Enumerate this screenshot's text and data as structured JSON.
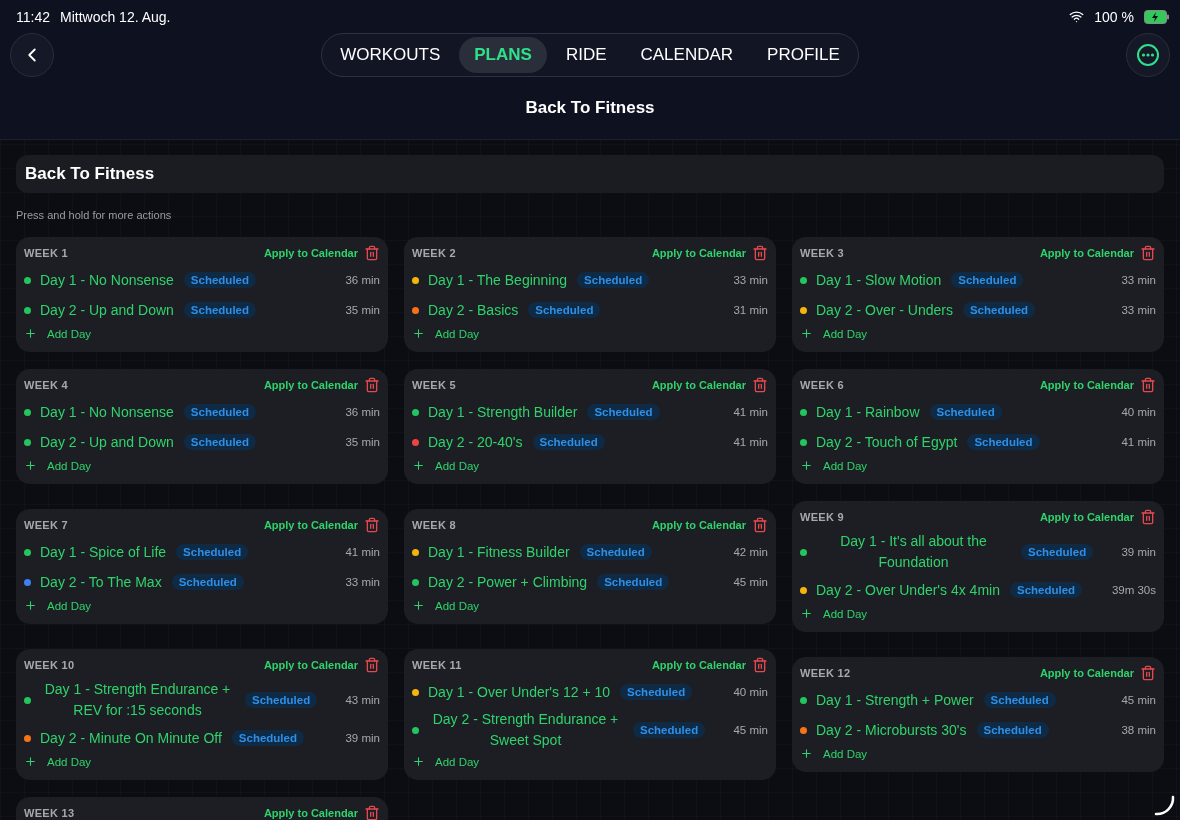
{
  "status_bar": {
    "time": "11:42",
    "date": "Mittwoch 12. Aug.",
    "battery": "100 %"
  },
  "tabs": [
    {
      "label": "WORKOUTS",
      "selected": false
    },
    {
      "label": "PLANS",
      "selected": true
    },
    {
      "label": "RIDE",
      "selected": false
    },
    {
      "label": "CALENDAR",
      "selected": false
    },
    {
      "label": "PROFILE",
      "selected": false
    }
  ],
  "page_title": "Back To Fitness",
  "plan_title": "Back To Fitness",
  "hint": "Press and hold for more actions",
  "weeks": [
    {
      "title": "WEEK 1",
      "action": "Apply to Calendar",
      "add_label": "Add Day",
      "days": [
        {
          "name": "Day 1 - No Nonsense",
          "status": "Scheduled",
          "duration": "36 min",
          "color": "#22c55e"
        },
        {
          "name": "Day 2 - Up and Down",
          "status": "Scheduled",
          "duration": "35 min",
          "color": "#22c55e"
        }
      ]
    },
    {
      "title": "WEEK 2",
      "action": "Apply to Calendar",
      "add_label": "Add Day",
      "days": [
        {
          "name": "Day 1 - The Beginning",
          "status": "Scheduled",
          "duration": "33 min",
          "color": "#f5b50a"
        },
        {
          "name": "Day 2 - Basics",
          "status": "Scheduled",
          "duration": "31 min",
          "color": "#f97316"
        }
      ]
    },
    {
      "title": "WEEK 3",
      "action": "Apply to Calendar",
      "add_label": "Add Day",
      "days": [
        {
          "name": "Day 1 - Slow Motion",
          "status": "Scheduled",
          "duration": "33 min",
          "color": "#22c55e"
        },
        {
          "name": "Day 2 - Over - Unders",
          "status": "Scheduled",
          "duration": "33 min",
          "color": "#f5b50a"
        }
      ]
    },
    {
      "title": "WEEK 4",
      "action": "Apply to Calendar",
      "add_label": "Add Day",
      "days": [
        {
          "name": "Day 1 - No Nonsense",
          "status": "Scheduled",
          "duration": "36 min",
          "color": "#22c55e"
        },
        {
          "name": "Day 2 - Up and Down",
          "status": "Scheduled",
          "duration": "35 min",
          "color": "#22c55e"
        }
      ]
    },
    {
      "title": "WEEK 5",
      "action": "Apply to Calendar",
      "add_label": "Add Day",
      "days": [
        {
          "name": "Day 1 - Strength Builder",
          "status": "Scheduled",
          "duration": "41 min",
          "color": "#22c55e"
        },
        {
          "name": "Day 2 - 20-40's",
          "status": "Scheduled",
          "duration": "41 min",
          "color": "#ef4444"
        }
      ]
    },
    {
      "title": "WEEK 6",
      "action": "Apply to Calendar",
      "add_label": "Add Day",
      "days": [
        {
          "name": "Day 1 - Rainbow",
          "status": "Scheduled",
          "duration": "40 min",
          "color": "#22c55e"
        },
        {
          "name": "Day 2 - Touch of Egypt",
          "status": "Scheduled",
          "duration": "41 min",
          "color": "#22c55e"
        }
      ]
    },
    {
      "title": "WEEK 7",
      "action": "Apply to Calendar",
      "add_label": "Add Day",
      "days": [
        {
          "name": "Day 1 - Spice of Life",
          "status": "Scheduled",
          "duration": "41 min",
          "color": "#22c55e"
        },
        {
          "name": "Day 2 - To The Max",
          "status": "Scheduled",
          "duration": "33 min",
          "color": "#3b82f6"
        }
      ]
    },
    {
      "title": "WEEK 8",
      "action": "Apply to Calendar",
      "add_label": "Add Day",
      "days": [
        {
          "name": "Day 1 - Fitness Builder",
          "status": "Scheduled",
          "duration": "42 min",
          "color": "#f5b50a"
        },
        {
          "name": "Day 2 - Power + Climbing",
          "status": "Scheduled",
          "duration": "45 min",
          "color": "#22c55e"
        }
      ]
    },
    {
      "title": "WEEK 9",
      "action": "Apply to Calendar",
      "add_label": "Add Day",
      "days": [
        {
          "name": "Day 1 - It's all about the Foundation",
          "status": "Scheduled",
          "duration": "39 min",
          "color": "#22c55e"
        },
        {
          "name": "Day 2 - Over Under's 4x 4min",
          "status": "Scheduled",
          "duration": "39m 30s",
          "color": "#f5b50a"
        }
      ]
    },
    {
      "title": "WEEK 10",
      "action": "Apply to Calendar",
      "add_label": "Add Day",
      "days": [
        {
          "name": "Day 1 - Strength Endurance + REV for :15 seconds",
          "status": "Scheduled",
          "duration": "43 min",
          "color": "#22c55e"
        },
        {
          "name": "Day 2 - Minute On Minute Off",
          "status": "Scheduled",
          "duration": "39 min",
          "color": "#f97316"
        }
      ]
    },
    {
      "title": "WEEK 11",
      "action": "Apply to Calendar",
      "add_label": "Add Day",
      "days": [
        {
          "name": "Day 1 - Over Under's 12 + 10",
          "status": "Scheduled",
          "duration": "40 min",
          "color": "#f5b50a"
        },
        {
          "name": "Day 2 - Strength Endurance + Sweet Spot",
          "status": "Scheduled",
          "duration": "45 min",
          "color": "#22c55e"
        }
      ]
    },
    {
      "title": "WEEK 12",
      "action": "Apply to Calendar",
      "add_label": "Add Day",
      "days": [
        {
          "name": "Day 1 - Strength + Power",
          "status": "Scheduled",
          "duration": "45 min",
          "color": "#22c55e"
        },
        {
          "name": "Day 2 - Microbursts 30's",
          "status": "Scheduled",
          "duration": "38 min",
          "color": "#f97316"
        }
      ]
    },
    {
      "title": "WEEK 13",
      "action": "Apply to Calendar"
    }
  ]
}
